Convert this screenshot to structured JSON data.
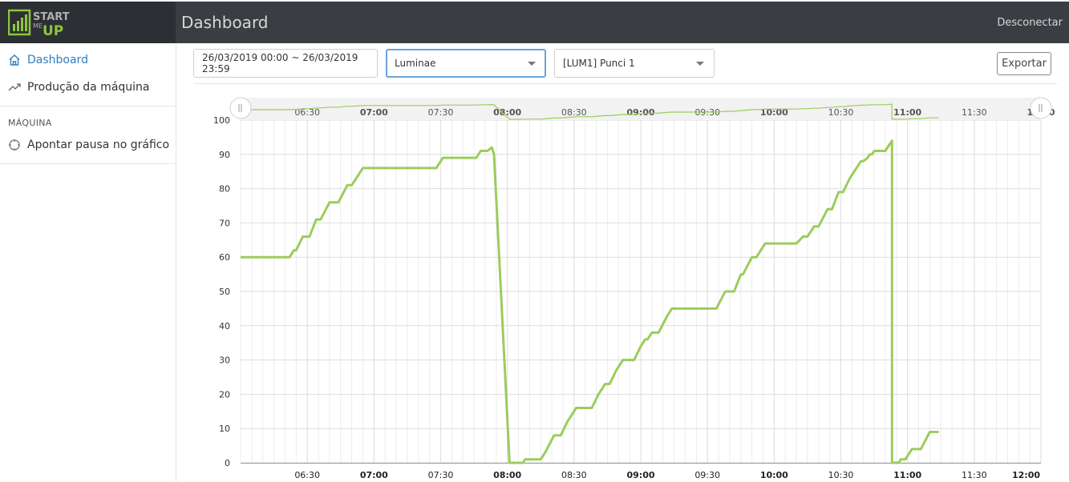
{
  "header": {
    "title": "Dashboard",
    "logout_label": "Desconectar"
  },
  "logo": {
    "line1": "START",
    "line2": "ME",
    "line3": "UP",
    "color": "#8cc63f"
  },
  "sidebar": {
    "items": [
      {
        "label": "Dashboard",
        "icon": "home-icon",
        "active": true
      },
      {
        "label": "Produção da máquina",
        "icon": "trend-icon",
        "active": false
      }
    ],
    "section_label": "MÁQUINA",
    "section_items": [
      {
        "label": "Apontar pausa no gráfico",
        "icon": "crosshair-icon"
      }
    ]
  },
  "filters": {
    "date_range": "26/03/2019 00:00 ~ 26/03/2019 23:59",
    "company": "Luminae",
    "machine": "[LUM1] Punci 1",
    "export_label": "Exportar"
  },
  "colors": {
    "accent": "#2f7ec1",
    "series": "#9ccc5c",
    "topbar": "#3a3d42"
  },
  "chart_data": {
    "type": "line",
    "x_unit": "time (HH:MM), 2019-03-26",
    "x_range": [
      "06:00",
      "12:00"
    ],
    "ylim": [
      0,
      100
    ],
    "y_ticks": [
      0,
      10,
      20,
      30,
      40,
      50,
      60,
      70,
      80,
      90,
      100
    ],
    "x_ticks": [
      {
        "label": "06:30",
        "bold": false
      },
      {
        "label": "07:00",
        "bold": true
      },
      {
        "label": "07:30",
        "bold": false
      },
      {
        "label": "08:00",
        "bold": true
      },
      {
        "label": "08:30",
        "bold": false
      },
      {
        "label": "09:00",
        "bold": true
      },
      {
        "label": "09:30",
        "bold": false
      },
      {
        "label": "10:00",
        "bold": true
      },
      {
        "label": "10:30",
        "bold": false
      },
      {
        "label": "11:00",
        "bold": true
      },
      {
        "label": "11:30",
        "bold": false
      },
      {
        "label": "12:00",
        "bold": true
      }
    ],
    "navigator_ticks": [
      "06:30",
      "07:00",
      "07:30",
      "08:00",
      "08:30",
      "09:00",
      "09:30",
      "10:00",
      "10:30",
      "11:00",
      "11:30",
      "12:00"
    ],
    "grid": true,
    "series": [
      {
        "points": [
          [
            "06:00",
            60
          ],
          [
            "06:22",
            60
          ],
          [
            "06:24",
            62
          ],
          [
            "06:25",
            62
          ],
          [
            "06:28",
            66
          ],
          [
            "06:31",
            66
          ],
          [
            "06:34",
            71
          ],
          [
            "06:36",
            71
          ],
          [
            "06:40",
            76
          ],
          [
            "06:44",
            76
          ],
          [
            "06:48",
            81
          ],
          [
            "06:50",
            81
          ],
          [
            "06:55",
            86
          ],
          [
            "07:28",
            86
          ],
          [
            "07:31",
            89
          ],
          [
            "07:46",
            89
          ],
          [
            "07:48",
            91
          ],
          [
            "07:51",
            91
          ],
          [
            "07:53",
            92
          ],
          [
            "07:54",
            90
          ],
          [
            "08:01",
            0
          ],
          [
            "08:07",
            0
          ],
          [
            "08:08",
            1
          ],
          [
            "08:15",
            1
          ],
          [
            "08:17",
            3
          ],
          [
            "08:21",
            8
          ],
          [
            "08:24",
            8
          ],
          [
            "08:27",
            12
          ],
          [
            "08:31",
            16
          ],
          [
            "08:38",
            16
          ],
          [
            "08:41",
            20
          ],
          [
            "08:44",
            23
          ],
          [
            "08:46",
            23
          ],
          [
            "08:49",
            27
          ],
          [
            "08:52",
            30
          ],
          [
            "08:57",
            30
          ],
          [
            "09:00",
            34
          ],
          [
            "09:02",
            36
          ],
          [
            "09:03",
            36
          ],
          [
            "09:05",
            38
          ],
          [
            "09:08",
            38
          ],
          [
            "09:12",
            43
          ],
          [
            "09:14",
            45
          ],
          [
            "09:34",
            45
          ],
          [
            "09:38",
            50
          ],
          [
            "09:42",
            50
          ],
          [
            "09:45",
            55
          ],
          [
            "09:46",
            55
          ],
          [
            "09:50",
            60
          ],
          [
            "09:52",
            60
          ],
          [
            "09:53",
            61
          ],
          [
            "09:56",
            64
          ],
          [
            "10:10",
            64
          ],
          [
            "10:13",
            66
          ],
          [
            "10:15",
            66
          ],
          [
            "10:18",
            69
          ],
          [
            "10:20",
            69
          ],
          [
            "10:24",
            74
          ],
          [
            "10:26",
            74
          ],
          [
            "10:29",
            79
          ],
          [
            "10:31",
            79
          ],
          [
            "10:34",
            83
          ],
          [
            "10:37",
            86
          ],
          [
            "10:39",
            88
          ],
          [
            "10:40",
            88
          ],
          [
            "10:42",
            89
          ],
          [
            "10:43",
            90
          ],
          [
            "10:44",
            90
          ],
          [
            "10:45",
            91
          ],
          [
            "10:50",
            91
          ],
          [
            "10:52",
            93
          ],
          [
            "10:53",
            94
          ],
          [
            "10:53",
            0
          ],
          [
            "10:56",
            0
          ],
          [
            "10:57",
            1
          ],
          [
            "10:59",
            1
          ],
          [
            "11:02",
            4
          ],
          [
            "11:06",
            4
          ],
          [
            "11:10",
            9
          ],
          [
            "11:14",
            9
          ]
        ]
      }
    ]
  }
}
